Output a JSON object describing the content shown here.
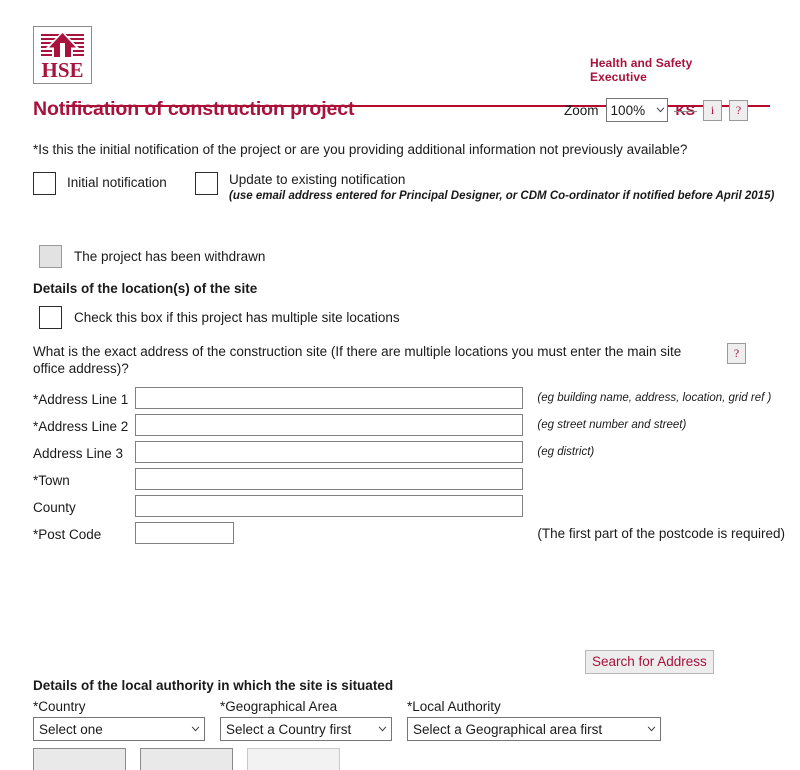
{
  "header": {
    "logo_alt": "HSE",
    "logo_text": "HSE",
    "org_line1": "Health and Safety",
    "org_line2": "Executive"
  },
  "title": "Notification of construction project",
  "toolbar": {
    "zoom_label": "Zoom",
    "zoom_value": "100%",
    "zoom_options": [
      "100%"
    ],
    "ks_label": "KS",
    "info_label": "i",
    "help_label": "?"
  },
  "questions": {
    "initial_or_update": "*Is this the initial notification of the project or are you providing additional information not previously available?",
    "initial_notification_label": "Initial notification",
    "update_notification_label": "Update to existing notification",
    "update_notification_note": "(use email address entered for Principal Designer, or CDM Co-ordinator if notified before April 2015)",
    "withdrawn_label": "The project has been withdrawn"
  },
  "location_section": {
    "heading": "Details of the location(s) of the site",
    "multiple_locations_label": "Check this box if this project has multiple site locations",
    "address_question": "What is the exact address of the construction site (If there are multiple locations you must enter the main site office address)?",
    "help_label": "?",
    "fields": [
      {
        "label": "*Address Line 1",
        "value": "",
        "hint": "(eg building name, address, location, grid ref )"
      },
      {
        "label": "*Address Line 2",
        "value": "",
        "hint": "(eg street number and street)"
      },
      {
        "label": "Address Line 3",
        "value": "",
        "hint": "(eg district)"
      },
      {
        "label": "*Town",
        "value": "",
        "hint": ""
      },
      {
        "label": "County",
        "value": "",
        "hint": ""
      },
      {
        "label": "*Post Code",
        "value": "",
        "hint": ""
      }
    ],
    "postcode_note": "(The first part of the postcode is required)",
    "search_button": "Search for Address"
  },
  "authority_section": {
    "heading": "Details of the local authority in which the site is situated",
    "country_label": "*Country",
    "country_value": "Select one",
    "geographical_label": "*Geographical Area",
    "geographical_value": "Select a Country first",
    "local_authority_label": "*Local Authority",
    "local_authority_value": "Select a Geographical area first"
  },
  "colors": {
    "brand_red": "#A8123C",
    "rule_red": "#B40A2E"
  }
}
